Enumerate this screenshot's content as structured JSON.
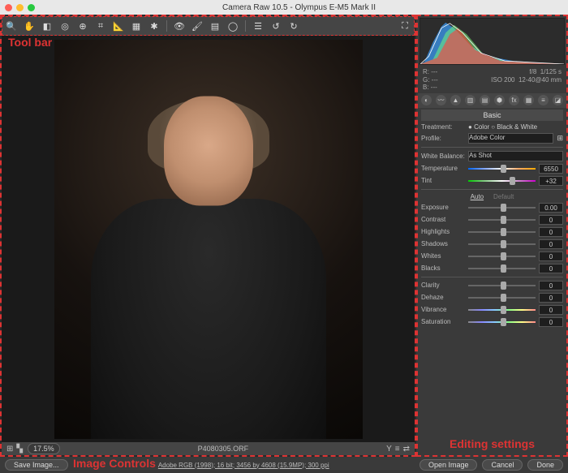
{
  "title": "Camera Raw 10.5  -  Olympus E-M5 Mark II",
  "toolbar_label": "Tool bar",
  "editing_label": "Editing settings",
  "controls_label": "Image Controls",
  "preview_filename": "P4080305.ORF",
  "zoom": "17.5%",
  "exif": {
    "r": "R:  ---",
    "g": "G:  ---",
    "b": "B:  ---",
    "f": "f/8",
    "shutter": "1/125 s",
    "iso": "ISO 200",
    "lens": "12-40@40 mm"
  },
  "panel_title": "Basic",
  "treatment": {
    "label": "Treatment:",
    "color": "Color",
    "bw": "Black & White"
  },
  "profile": {
    "label": "Profile:",
    "value": "Adobe Color"
  },
  "wb": {
    "label": "White Balance:",
    "value": "As Shot"
  },
  "temperature": {
    "label": "Temperature",
    "value": "6550"
  },
  "tint": {
    "label": "Tint",
    "value": "+32"
  },
  "auto": "Auto",
  "default": "Default",
  "sliders": {
    "exposure": {
      "label": "Exposure",
      "value": "0.00"
    },
    "contrast": {
      "label": "Contrast",
      "value": "0"
    },
    "highlights": {
      "label": "Highlights",
      "value": "0"
    },
    "shadows": {
      "label": "Shadows",
      "value": "0"
    },
    "whites": {
      "label": "Whites",
      "value": "0"
    },
    "blacks": {
      "label": "Blacks",
      "value": "0"
    },
    "clarity": {
      "label": "Clarity",
      "value": "0"
    },
    "dehaze": {
      "label": "Dehaze",
      "value": "0"
    },
    "vibrance": {
      "label": "Vibrance",
      "value": "0"
    },
    "saturation": {
      "label": "Saturation",
      "value": "0"
    }
  },
  "bottom": {
    "save": "Save Image...",
    "info": "Adobe RGB (1998); 16 bit; 3456 by 4608 (15.9MP); 300 ppi",
    "open": "Open Image",
    "cancel": "Cancel",
    "done": "Done"
  }
}
